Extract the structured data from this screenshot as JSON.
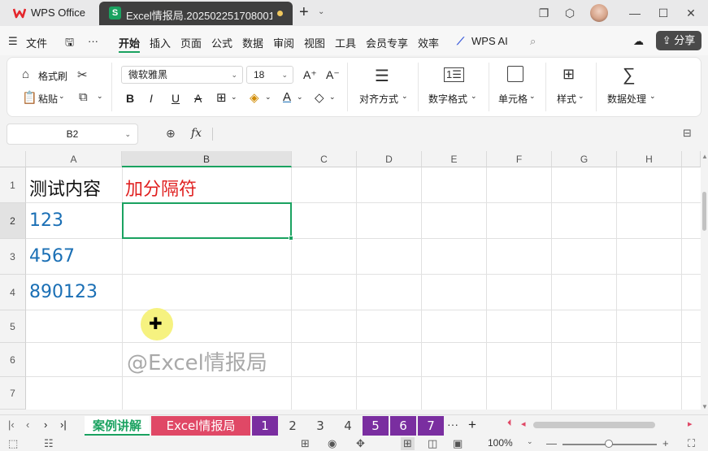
{
  "titlebar": {
    "app_name": "WPS Office",
    "doc_tab_title": "Excel情报局.202502251708001",
    "new_tab": "+",
    "colors": {
      "doc_icon": "#1aa260",
      "unsaved_dot": "#f0c75e"
    }
  },
  "menubar": {
    "file": "文件",
    "items": [
      "开始",
      "插入",
      "页面",
      "公式",
      "数据",
      "审阅",
      "视图",
      "工具",
      "会员专享",
      "效率"
    ],
    "ai": "WPS AI",
    "share": "分享"
  },
  "ribbon": {
    "format_painter": "格式刷",
    "paste": "粘贴",
    "font_name": "微软雅黑",
    "font_size": "18",
    "grow_font": "A⁺",
    "shrink_font": "A⁻",
    "align": "对齐方式",
    "number_format": "数字格式",
    "cells": "单元格",
    "styles": "样式",
    "data_processing": "数据处理"
  },
  "formula_bar": {
    "name_box": "B2",
    "fx": "fx",
    "content": ""
  },
  "grid": {
    "columns": [
      "A",
      "B",
      "C",
      "D",
      "E",
      "F",
      "G",
      "H"
    ],
    "rows": [
      "1",
      "2",
      "3",
      "4",
      "5",
      "6",
      "7"
    ],
    "selected_cell": "B2",
    "cells": {
      "A1": "测试内容",
      "B1": "加分隔符",
      "A2": "123",
      "A3": "4567",
      "A4": "890123"
    },
    "colors": {
      "header_red": "#e02020",
      "number_blue": "#1a6fb5",
      "selection": "#1aa260"
    },
    "watermark": "@Excel情报局"
  },
  "sheets": {
    "tabs": [
      {
        "label": "案例讲解",
        "active": true
      },
      {
        "label": "Excel情报局"
      },
      {
        "label": "1"
      },
      {
        "label": "2"
      },
      {
        "label": "3"
      },
      {
        "label": "4"
      },
      {
        "label": "5"
      },
      {
        "label": "6"
      },
      {
        "label": "7"
      }
    ],
    "more": "···",
    "add": "+"
  },
  "statusbar": {
    "zoom": "100%"
  }
}
